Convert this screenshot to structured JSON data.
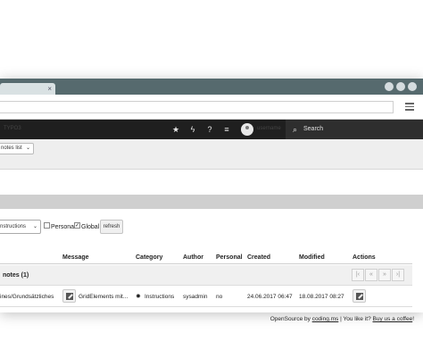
{
  "header": {
    "title": "TYPO3",
    "username": "username",
    "search_label": "Search"
  },
  "docheader": {
    "view_select": "notes list"
  },
  "filter": {
    "type_select": "nstructions",
    "personal_label": "Personal",
    "personal_checked": false,
    "global_label": "Global",
    "global_checked": true,
    "refresh_label": "refresh"
  },
  "table": {
    "columns": {
      "message": "Message",
      "category": "Category",
      "author": "Author",
      "personal": "Personal",
      "created": "Created",
      "modified": "Modified",
      "actions": "Actions"
    },
    "group_title": "notes (1)",
    "rows": [
      {
        "page": "ines/Grundsätzliches",
        "message": "GridElements mit...",
        "category": "Instructions",
        "author": "sysadmin",
        "personal": "no",
        "created": "24.06.2017 06:47",
        "modified": "18.08.2017 08:27"
      }
    ]
  },
  "footer": {
    "prefix": "OpenSource by ",
    "link1": "coding.ms",
    "middle": " | You like it? ",
    "link2": "Buy us a coffee",
    "suffix": "!"
  },
  "icons": {
    "bookmark": "star-icon",
    "flash": "bolt-icon",
    "help": "help-icon",
    "system_info": "list-icon"
  }
}
